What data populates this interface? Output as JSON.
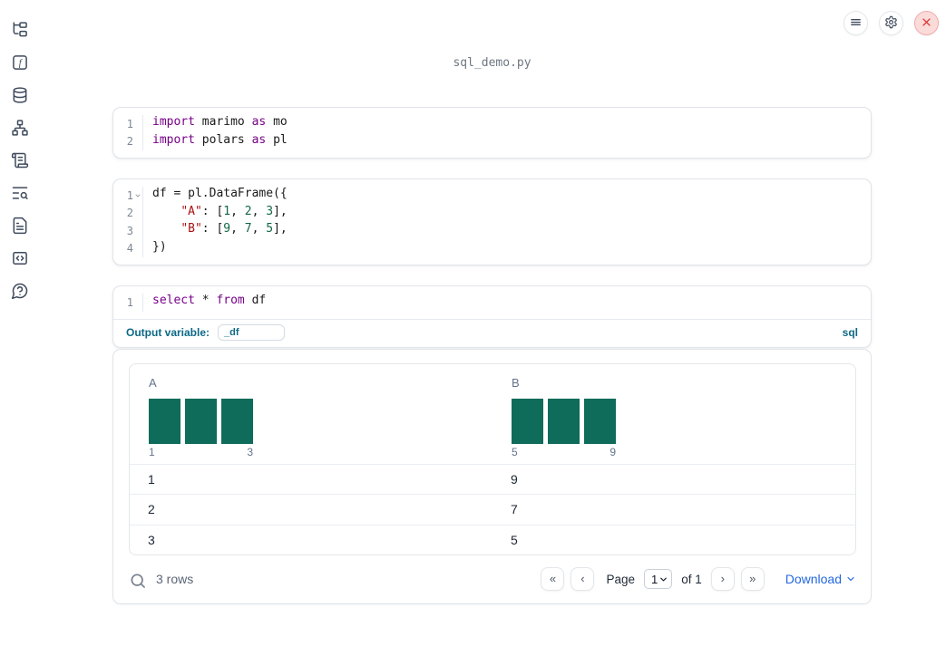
{
  "app": {
    "title": "sql_demo.py"
  },
  "colors": {
    "keyword": "#770088",
    "string": "#aa1111",
    "number": "#116644",
    "histogram_bar": "#0f6b5a",
    "sql_accent": "#0d6986",
    "link_blue": "#2468e0",
    "close_button_bg": "#fbdada",
    "close_button_x": "#d93636"
  },
  "sidebar": {
    "items": [
      {
        "name": "file-explorer"
      },
      {
        "name": "variables"
      },
      {
        "name": "datasources"
      },
      {
        "name": "dependency-graph"
      },
      {
        "name": "scratchpad"
      },
      {
        "name": "logs"
      },
      {
        "name": "documentation"
      },
      {
        "name": "snippets"
      },
      {
        "name": "help"
      }
    ]
  },
  "cells": [
    {
      "lines": [
        {
          "n": "1",
          "tokens": [
            {
              "t": "k",
              "v": "import"
            },
            {
              "t": "p",
              "v": " marimo "
            },
            {
              "t": "k",
              "v": "as"
            },
            {
              "t": "p",
              "v": " mo"
            }
          ]
        },
        {
          "n": "2",
          "tokens": [
            {
              "t": "k",
              "v": "import"
            },
            {
              "t": "p",
              "v": " polars "
            },
            {
              "t": "k",
              "v": "as"
            },
            {
              "t": "p",
              "v": " pl"
            }
          ]
        }
      ]
    },
    {
      "lines": [
        {
          "n": "1",
          "fold": true,
          "tokens": [
            {
              "t": "p",
              "v": "df = pl.DataFrame({"
            }
          ]
        },
        {
          "n": "2",
          "tokens": [
            {
              "t": "p",
              "v": "    "
            },
            {
              "t": "s",
              "v": "\"A\""
            },
            {
              "t": "p",
              "v": ": ["
            },
            {
              "t": "n",
              "v": "1"
            },
            {
              "t": "p",
              "v": ", "
            },
            {
              "t": "n",
              "v": "2"
            },
            {
              "t": "p",
              "v": ", "
            },
            {
              "t": "n",
              "v": "3"
            },
            {
              "t": "p",
              "v": "],"
            }
          ]
        },
        {
          "n": "3",
          "tokens": [
            {
              "t": "p",
              "v": "    "
            },
            {
              "t": "s",
              "v": "\"B\""
            },
            {
              "t": "p",
              "v": ": ["
            },
            {
              "t": "n",
              "v": "9"
            },
            {
              "t": "p",
              "v": ", "
            },
            {
              "t": "n",
              "v": "7"
            },
            {
              "t": "p",
              "v": ", "
            },
            {
              "t": "n",
              "v": "5"
            },
            {
              "t": "p",
              "v": "],"
            }
          ]
        },
        {
          "n": "4",
          "tokens": [
            {
              "t": "p",
              "v": "})"
            }
          ]
        }
      ]
    },
    {
      "lines": [
        {
          "n": "1",
          "tokens": [
            {
              "t": "k",
              "v": "select"
            },
            {
              "t": "p",
              "v": " * "
            },
            {
              "t": "k",
              "v": "from"
            },
            {
              "t": "p",
              "v": " df"
            }
          ]
        }
      ]
    }
  ],
  "sql_cell": {
    "output_variable_label": "Output variable:",
    "output_variable_value": "_df",
    "language_badge": "sql"
  },
  "table": {
    "columns": [
      {
        "name": "A",
        "histogram": {
          "bar_count": 3,
          "min_label": "1",
          "max_label": "3",
          "values": [
            1,
            2,
            3
          ]
        }
      },
      {
        "name": "B",
        "histogram": {
          "bar_count": 3,
          "min_label": "5",
          "max_label": "9",
          "values": [
            9,
            7,
            5
          ]
        }
      }
    ],
    "rows": [
      [
        "1",
        "9"
      ],
      [
        "2",
        "7"
      ],
      [
        "3",
        "5"
      ]
    ],
    "footer": {
      "row_count": "3 rows",
      "first": "«",
      "prev": "‹",
      "next": "›",
      "last": "»",
      "page_label": "Page",
      "page_value": "1",
      "of_label": "of 1",
      "download_label": "Download"
    }
  }
}
